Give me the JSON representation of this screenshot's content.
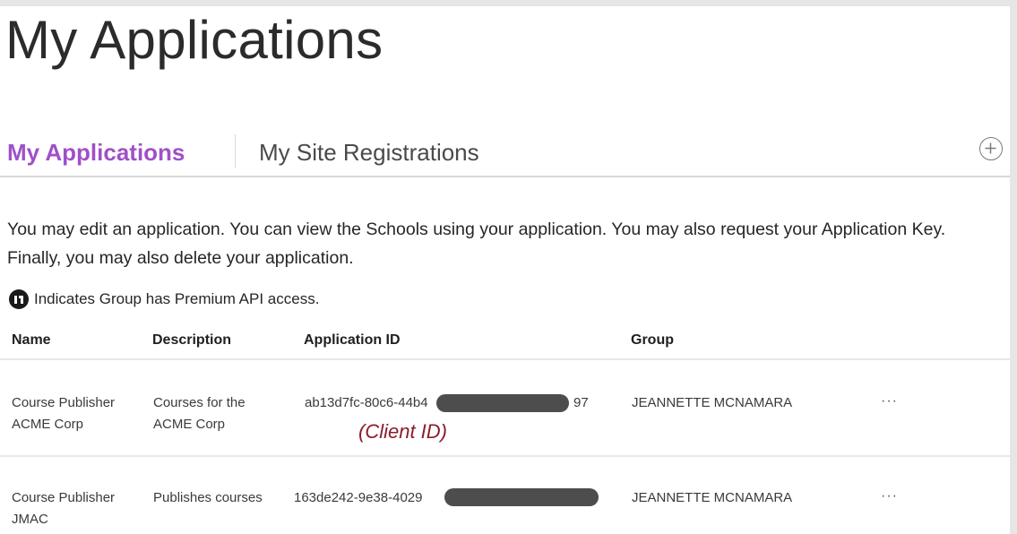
{
  "page": {
    "title": "My Applications"
  },
  "tabs": {
    "active_label": "My Applications",
    "inactive_label": "My Site Registrations",
    "add_icon": "plus-circle-icon"
  },
  "intro": {
    "text": "You may edit an application. You can view the Schools using your application. You may also request your Application Key. Finally, you may also delete your application."
  },
  "premium_note": {
    "icon": "premium-api-icon",
    "text": "Indicates Group has Premium API access."
  },
  "table": {
    "headers": {
      "name": "Name",
      "description": "Description",
      "application_id": "Application ID",
      "group": "Group"
    },
    "rows": [
      {
        "name": "Course Publisher ACME Corp",
        "description": "Courses for the ACME Corp",
        "application_id_prefix": "ab13d7fc-80c6-44b4",
        "application_id_suffix": "97",
        "group": "JEANNETTE MCNAMARA",
        "more": "···"
      },
      {
        "name": "Course Publisher JMAC",
        "description": "Publishes courses",
        "application_id_prefix": "163de242-9e38-4029",
        "application_id_suffix": "",
        "group": "JEANNETTE MCNAMARA",
        "more": "···"
      }
    ]
  },
  "annotation": {
    "client_id_label": "(Client ID)"
  },
  "colors": {
    "accent": "#a050c8",
    "annotation": "#8b1d2c",
    "redaction": "#4d4d4d",
    "background": "#e6e6e6"
  }
}
